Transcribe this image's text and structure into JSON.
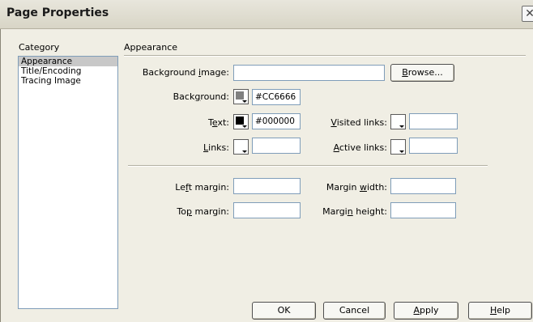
{
  "window": {
    "title": "Page Properties",
    "close_glyph": "✕"
  },
  "category": {
    "header": "Category",
    "items": [
      "Appearance",
      "Title/Encoding",
      "Tracing Image"
    ],
    "selected": "Appearance"
  },
  "appearance": {
    "section_title": "Appearance",
    "background_image": {
      "label_pre": "Background ",
      "label_u": "i",
      "label_post": "mage:",
      "value": ""
    },
    "browse": {
      "u": "B",
      "rest": "rowse..."
    },
    "background": {
      "label_pre": "Back",
      "label_u": "g",
      "label_post": "round:",
      "value": "#CC6666",
      "swatch_color": "#808080"
    },
    "text": {
      "label_pre": "T",
      "label_u": "e",
      "label_post": "xt:",
      "value": "#000000",
      "swatch_color": "#000000"
    },
    "links": {
      "label_u": "L",
      "label_post": "inks:",
      "value": ""
    },
    "visited_links": {
      "label_u": "V",
      "label_post": "isited links:",
      "value": ""
    },
    "active_links": {
      "label_u": "A",
      "label_post": "ctive links:",
      "value": ""
    },
    "left_margin": {
      "label_pre": "Le",
      "label_u": "f",
      "label_post": "t margin:",
      "value": ""
    },
    "top_margin": {
      "label_pre": "To",
      "label_u": "p",
      "label_post": " margin:",
      "value": ""
    },
    "margin_width": {
      "label_pre": "Margin ",
      "label_u": "w",
      "label_post": "idth:",
      "value": ""
    },
    "margin_height": {
      "label_pre": "Margi",
      "label_u": "n",
      "label_post": " height:",
      "value": ""
    }
  },
  "buttons": {
    "ok": "OK",
    "cancel": "Cancel",
    "apply": {
      "u": "A",
      "rest": "pply"
    },
    "help": {
      "u": "H",
      "rest": "elp"
    }
  }
}
